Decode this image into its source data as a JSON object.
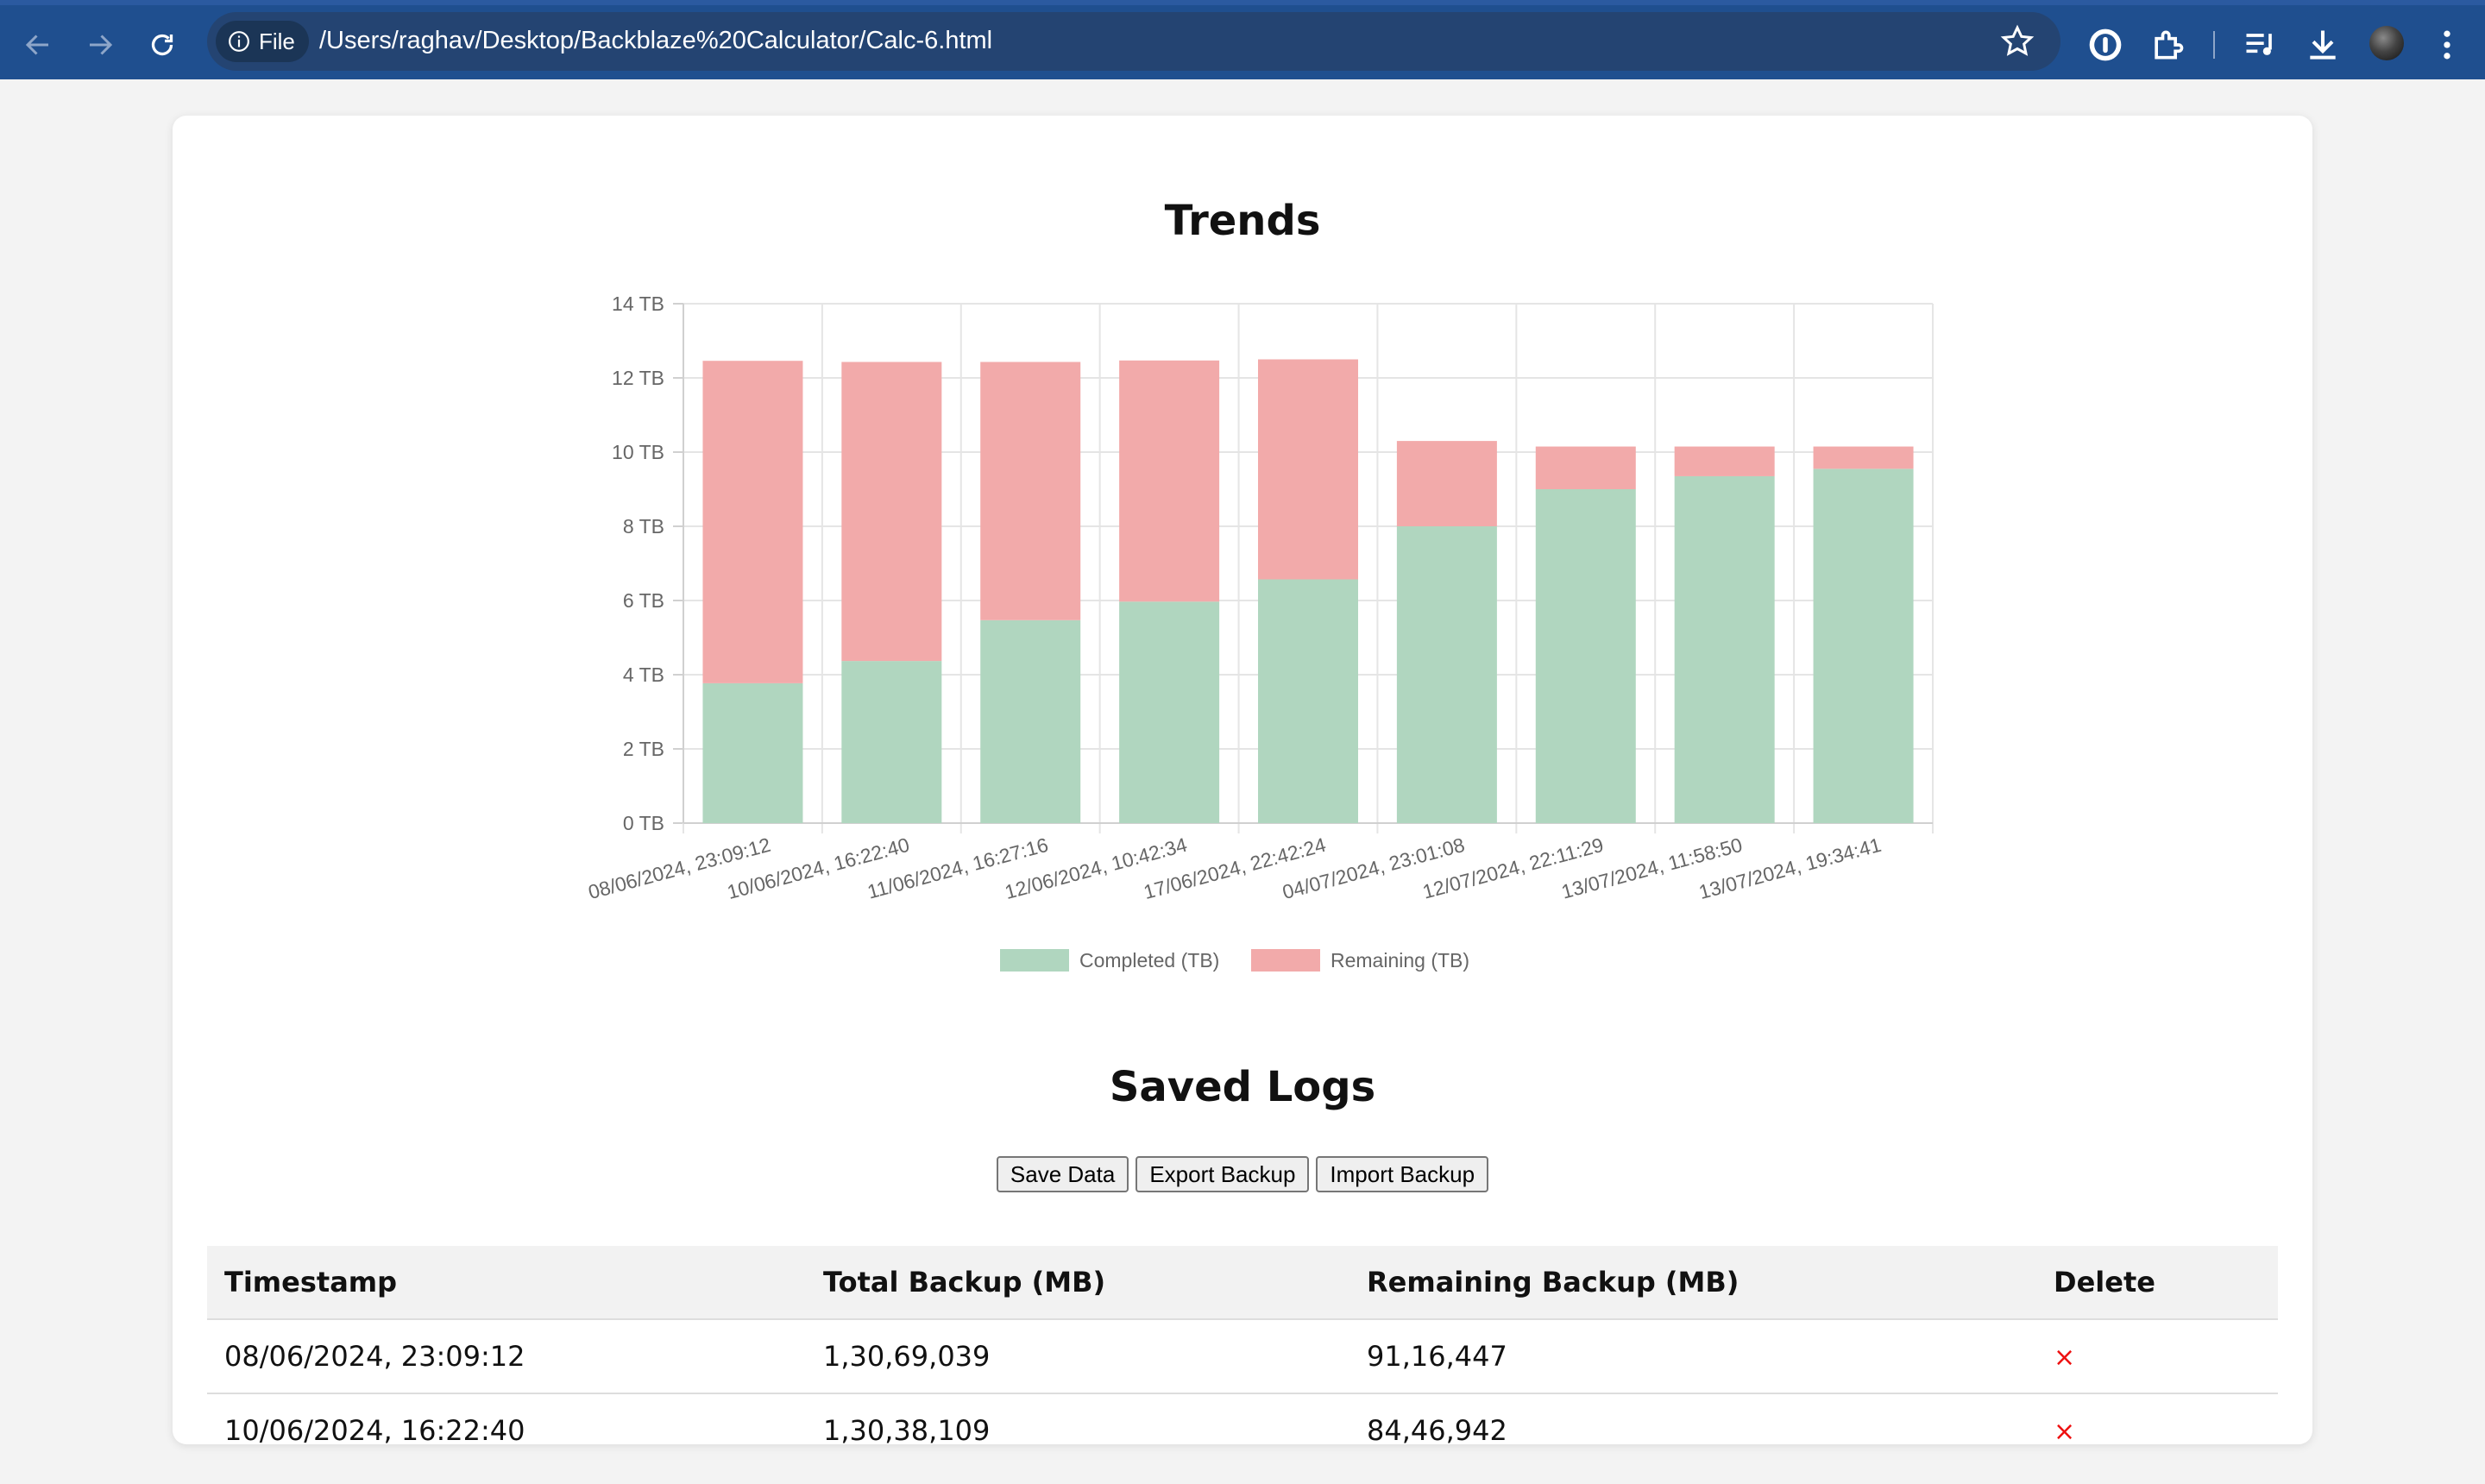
{
  "browser": {
    "chip_label": "File",
    "url": "/Users/raghav/Desktop/Backblaze%20Calculator/Calc-6.html"
  },
  "page": {
    "trends_title": "Trends",
    "logs_title": "Saved Logs",
    "buttons": {
      "save": "Save Data",
      "export": "Export Backup",
      "import": "Import Backup"
    },
    "table": {
      "headers": [
        "Timestamp",
        "Total Backup (MB)",
        "Remaining Backup (MB)",
        "Delete"
      ],
      "rows": [
        {
          "timestamp": "08/06/2024, 23:09:12",
          "total": "1,30,69,039",
          "remaining": "91,16,447",
          "delete": "×"
        },
        {
          "timestamp": "10/06/2024, 16:22:40",
          "total": "1,30,38,109",
          "remaining": "84,46,942",
          "delete": "×"
        }
      ]
    }
  },
  "chart_data": {
    "type": "bar",
    "stacked": true,
    "categories": [
      "08/06/2024, 23:09:12",
      "10/06/2024, 16:22:40",
      "11/06/2024, 16:27:16",
      "12/06/2024, 10:42:34",
      "17/06/2024, 22:42:24",
      "04/07/2024, 23:01:08",
      "12/07/2024, 22:11:29",
      "13/07/2024, 11:58:50",
      "13/07/2024, 19:34:41"
    ],
    "series": [
      {
        "name": "Completed (TB)",
        "color": "#b0d6bf",
        "values": [
          3.77,
          4.37,
          5.47,
          5.97,
          6.57,
          8.0,
          9.0,
          9.35,
          9.55
        ]
      },
      {
        "name": "Remaining (TB)",
        "color": "#f2aaaa",
        "values": [
          8.69,
          8.06,
          6.96,
          6.5,
          5.93,
          2.3,
          1.15,
          0.8,
          0.6
        ]
      }
    ],
    "y_ticks": [
      "0 TB",
      "2 TB",
      "4 TB",
      "6 TB",
      "8 TB",
      "10 TB",
      "12 TB",
      "14 TB"
    ],
    "ylim": [
      0,
      14
    ],
    "grid": true,
    "legend_position": "bottom"
  }
}
